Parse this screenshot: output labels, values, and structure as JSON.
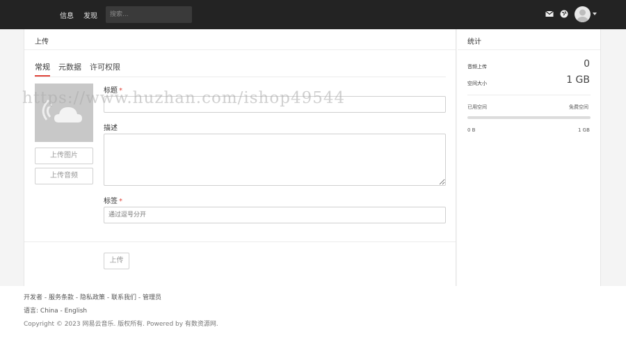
{
  "nav": {
    "items": [
      "信息",
      "发现"
    ],
    "search_placeholder": "搜索..."
  },
  "upload_panel": {
    "title": "上传",
    "tabs": [
      "常规",
      "元数据",
      "许可权限"
    ],
    "active_tab": "常规",
    "upload_image_label": "上传图片",
    "upload_audio_label": "上传音频",
    "title_label": "标题",
    "required_mark": "*",
    "description_label": "描述",
    "tags_label": "标签",
    "tags_placeholder": "通过逗号分开",
    "submit_label": "上传"
  },
  "stats": {
    "title": "统计",
    "songs_uploaded_label": "音频上传",
    "songs_uploaded_value": "0",
    "space_size_label": "空间大小",
    "space_size_value": "1 GB",
    "used_space_label": "已用空间",
    "free_space_label": "免费空间",
    "progress_min": "0 B",
    "progress_max": "1 GB",
    "used_fraction": 0
  },
  "footer": {
    "links": [
      "开发者",
      "服务条款",
      "隐私政策",
      "联系我们",
      "管理员"
    ],
    "language_label": "语言:",
    "languages": [
      "China",
      "English"
    ],
    "copyright": "Copyright © 2023 网易云音乐. 版权所有. Powered by 有数资源网."
  },
  "watermark": "https://www.huzhan.com/ishop49544",
  "colors": {
    "topbar": "#232323",
    "accent": "#e0443a"
  }
}
